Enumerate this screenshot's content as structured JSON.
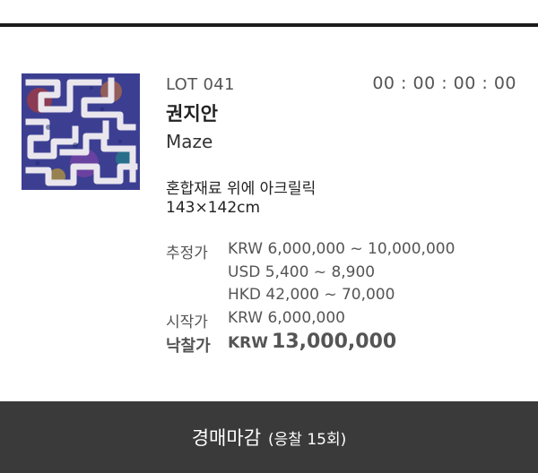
{
  "lot": {
    "number_label": "LOT 041",
    "timer": "00 : 00 : 00 : 00"
  },
  "artwork": {
    "artist": "권지안",
    "title": "Maze",
    "medium": "혼합재료 위에 아크릴릭",
    "size": "143×142cm",
    "image_name": "maze-artwork-thumbnail"
  },
  "prices": {
    "estimate_label": "추정가",
    "estimate_krw": "KRW 6,000,000 ~ 10,000,000",
    "estimate_usd": "USD 5,400 ~ 8,900",
    "estimate_hkd": "HKD 42,000 ~ 70,000",
    "start_label": "시작가",
    "start_value": "KRW 6,000,000",
    "hammer_label": "낙찰가",
    "hammer_currency": "KRW",
    "hammer_amount": "13,000,000"
  },
  "footer": {
    "status": "경매마감",
    "bids": "(응찰 15회)"
  },
  "colors": {
    "footer_bg": "#3a3a3a",
    "top_rule": "#1c1c1c",
    "text_muted": "#555555"
  }
}
